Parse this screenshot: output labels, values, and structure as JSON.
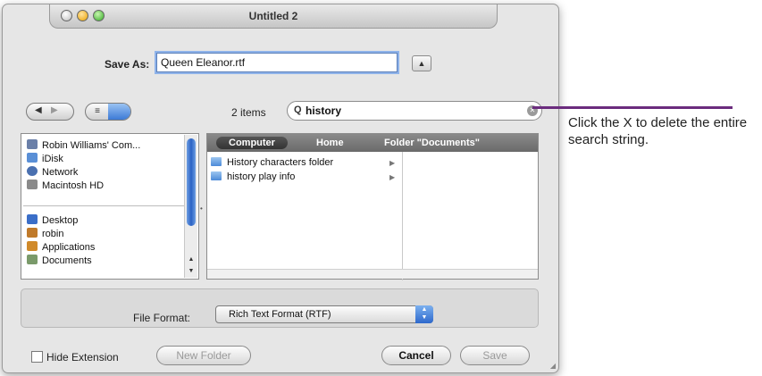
{
  "window": {
    "title": "Untitled 2"
  },
  "save_as": {
    "label": "Save As:",
    "filename": "Queen Eleanor.rtf"
  },
  "toolbar": {
    "items_count": "2 items",
    "search_query": "history"
  },
  "sidebar": {
    "devices": [
      {
        "label": "Robin Williams' Com...",
        "icon": "computer-icon",
        "color": "#6a7fa8"
      },
      {
        "label": "iDisk",
        "icon": "idisk-icon",
        "color": "#5a8fd6"
      },
      {
        "label": "Network",
        "icon": "network-icon",
        "color": "#4a70b0"
      },
      {
        "label": "Macintosh HD",
        "icon": "hard-drive-icon",
        "color": "#8a8a8a"
      }
    ],
    "places": [
      {
        "label": "Desktop",
        "icon": "desktop-icon",
        "color": "#3a6ec8"
      },
      {
        "label": "robin",
        "icon": "home-icon",
        "color": "#c07a2a"
      },
      {
        "label": "Applications",
        "icon": "applications-icon",
        "color": "#d08a2a"
      },
      {
        "label": "Documents",
        "icon": "documents-icon",
        "color": "#7a9a6a"
      }
    ]
  },
  "browser": {
    "path": [
      "Computer",
      "Home",
      "Folder \"Documents\""
    ],
    "results": [
      "History characters folder",
      "history play info"
    ]
  },
  "file_format": {
    "label": "File Format:",
    "value": "Rich Text Format (RTF)"
  },
  "footer": {
    "hide_extension": "Hide Extension",
    "new_folder": "New Folder",
    "cancel": "Cancel",
    "save": "Save"
  },
  "callout": {
    "text": "Click the X to delete the entire search string.",
    "line_color": "#6b2c7e"
  }
}
